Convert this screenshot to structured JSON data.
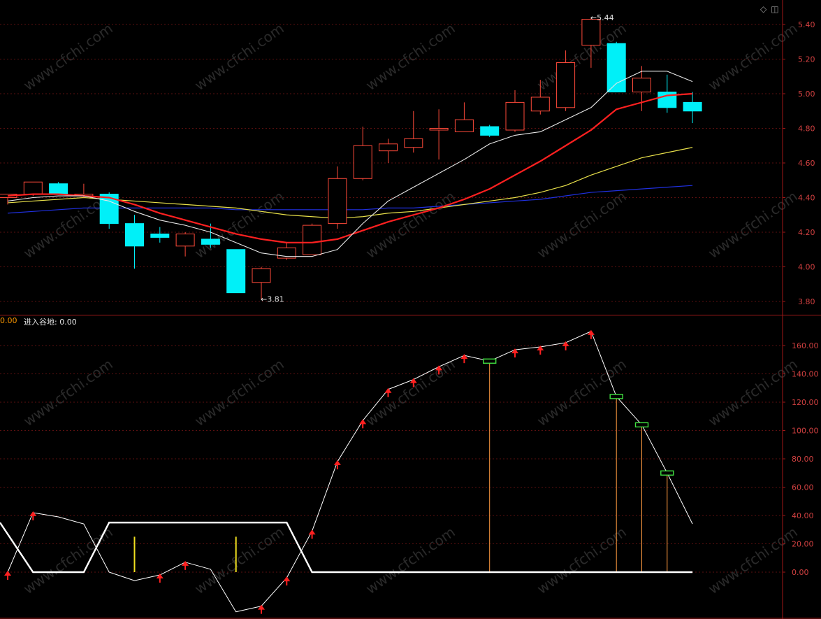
{
  "colors": {
    "background": "#000000",
    "frame": "#a01818",
    "grid": "#5a1010",
    "tick_text": "#d04040",
    "candle_up": "#ff4a3a",
    "candle_down": "#00f0f8",
    "ma_white": "#e8e8e8",
    "ma_red": "#ff2020",
    "ma_yellow": "#e8e04a",
    "ma_blue": "#2030e0",
    "indicator_line": "#ffffff",
    "arrow": "#ff2020",
    "signal_box": "#40e040",
    "signal_stick": "#ff9a40",
    "yellow_stick": "#f0e020"
  },
  "icons": [
    "diamond-icon",
    "settings-square-icon"
  ],
  "indicator": {
    "prefix": "0.00",
    "name_label": "进入谷地: 0.00"
  },
  "chart_data": [
    {
      "type": "candlestick",
      "title": "",
      "ylim": [
        3.72,
        5.5
      ],
      "yticks": [
        "5.40",
        "5.20",
        "5.00",
        "4.80",
        "4.60",
        "4.40",
        "4.20",
        "4.00",
        "3.80"
      ],
      "grid": true,
      "annotations": [
        {
          "text": "5.44",
          "candle_index": 23,
          "at": "high"
        },
        {
          "text": "3.81",
          "candle_index": 10,
          "at": "low"
        }
      ],
      "candles": [
        {
          "o": 4.4,
          "h": 4.42,
          "l": 4.36,
          "c": 4.42
        },
        {
          "o": 4.42,
          "h": 4.49,
          "l": 4.41,
          "c": 4.49
        },
        {
          "o": 4.48,
          "h": 4.49,
          "l": 4.42,
          "c": 4.42
        },
        {
          "o": 4.41,
          "h": 4.48,
          "l": 4.4,
          "c": 4.42
        },
        {
          "o": 4.42,
          "h": 4.43,
          "l": 4.22,
          "c": 4.25
        },
        {
          "o": 4.25,
          "h": 4.3,
          "l": 3.99,
          "c": 4.12
        },
        {
          "o": 4.19,
          "h": 4.23,
          "l": 4.14,
          "c": 4.17
        },
        {
          "o": 4.12,
          "h": 4.2,
          "l": 4.06,
          "c": 4.19
        },
        {
          "o": 4.16,
          "h": 4.25,
          "l": 4.11,
          "c": 4.13
        },
        {
          "o": 4.1,
          "h": 4.1,
          "l": 3.85,
          "c": 3.85
        },
        {
          "o": 3.91,
          "h": 4.0,
          "l": 3.81,
          "c": 3.99
        },
        {
          "o": 4.05,
          "h": 4.14,
          "l": 4.04,
          "c": 4.11
        },
        {
          "o": 4.07,
          "h": 4.25,
          "l": 4.07,
          "c": 4.24
        },
        {
          "o": 4.25,
          "h": 4.58,
          "l": 4.22,
          "c": 4.51
        },
        {
          "o": 4.51,
          "h": 4.81,
          "l": 4.5,
          "c": 4.7
        },
        {
          "o": 4.67,
          "h": 4.74,
          "l": 4.6,
          "c": 4.71
        },
        {
          "o": 4.69,
          "h": 4.9,
          "l": 4.66,
          "c": 4.74
        },
        {
          "o": 4.79,
          "h": 4.91,
          "l": 4.62,
          "c": 4.8
        },
        {
          "o": 4.78,
          "h": 4.95,
          "l": 4.78,
          "c": 4.85
        },
        {
          "o": 4.81,
          "h": 4.82,
          "l": 4.75,
          "c": 4.76
        },
        {
          "o": 4.79,
          "h": 5.02,
          "l": 4.78,
          "c": 4.95
        },
        {
          "o": 4.9,
          "h": 5.08,
          "l": 4.88,
          "c": 4.98
        },
        {
          "o": 4.92,
          "h": 5.25,
          "l": 4.9,
          "c": 5.18
        },
        {
          "o": 5.28,
          "h": 5.44,
          "l": 5.15,
          "c": 5.43
        },
        {
          "o": 5.29,
          "h": 5.3,
          "l": 5.01,
          "c": 5.01
        },
        {
          "o": 5.01,
          "h": 5.16,
          "l": 4.9,
          "c": 5.09
        },
        {
          "o": 5.01,
          "h": 5.11,
          "l": 4.89,
          "c": 4.92
        },
        {
          "o": 4.95,
          "h": 5.01,
          "l": 4.83,
          "c": 4.9
        }
      ],
      "ma_white": [
        4.38,
        4.4,
        4.41,
        4.41,
        4.38,
        4.32,
        4.27,
        4.24,
        4.2,
        4.14,
        4.08,
        4.06,
        4.06,
        4.1,
        4.25,
        4.38,
        4.46,
        4.54,
        4.62,
        4.71,
        4.76,
        4.78,
        4.85,
        4.92,
        5.06,
        5.13,
        5.13,
        5.07
      ],
      "ma_red": [
        4.41,
        4.42,
        4.42,
        4.41,
        4.4,
        4.36,
        4.31,
        4.27,
        4.23,
        4.19,
        4.16,
        4.14,
        4.14,
        4.16,
        4.21,
        4.26,
        4.3,
        4.34,
        4.39,
        4.45,
        4.53,
        4.61,
        4.7,
        4.79,
        4.91,
        4.95,
        4.99,
        5.0
      ],
      "ma_yellow": [
        4.37,
        4.38,
        4.39,
        4.4,
        4.39,
        4.38,
        4.37,
        4.36,
        4.35,
        4.34,
        4.32,
        4.3,
        4.29,
        4.28,
        4.29,
        4.31,
        4.32,
        4.34,
        4.36,
        4.38,
        4.4,
        4.43,
        4.47,
        4.53,
        4.58,
        4.63,
        4.66,
        4.69
      ],
      "ma_blue": [
        4.31,
        4.32,
        4.33,
        4.34,
        4.34,
        4.34,
        4.34,
        4.34,
        4.34,
        4.33,
        4.33,
        4.33,
        4.33,
        4.33,
        4.33,
        4.34,
        4.34,
        4.35,
        4.36,
        4.37,
        4.38,
        4.39,
        4.41,
        4.43,
        4.44,
        4.45,
        4.46,
        4.47
      ]
    },
    {
      "type": "line",
      "title": "",
      "ylim": [
        -30,
        175
      ],
      "yticks": [
        "160.00",
        "140.00",
        "120.00",
        "100.00",
        "80.00",
        "60.00",
        "40.00",
        "20.00",
        "0.00"
      ],
      "grid": true,
      "main_line": [
        0,
        42,
        39,
        34,
        0,
        -6,
        -2,
        7,
        2,
        -28,
        -24,
        -4,
        29,
        78,
        107,
        129,
        136,
        145,
        153,
        149,
        157,
        159,
        162,
        170,
        124,
        104,
        70,
        34
      ],
      "white_step": [
        35,
        0,
        0,
        0,
        35,
        35,
        35,
        35,
        35,
        35,
        35,
        35,
        0,
        0,
        0,
        0,
        0,
        0,
        0,
        0,
        0,
        0,
        0,
        0,
        0,
        0,
        0,
        0
      ],
      "arrow_indices": [
        0,
        1,
        6,
        7,
        10,
        11,
        12,
        13,
        14,
        15,
        16,
        17,
        18,
        20,
        21,
        22,
        23
      ],
      "signal_indices": [
        19,
        24,
        25,
        26
      ],
      "yellow_stick_indices": [
        5,
        9
      ],
      "yellow_stick_height": 25
    }
  ]
}
